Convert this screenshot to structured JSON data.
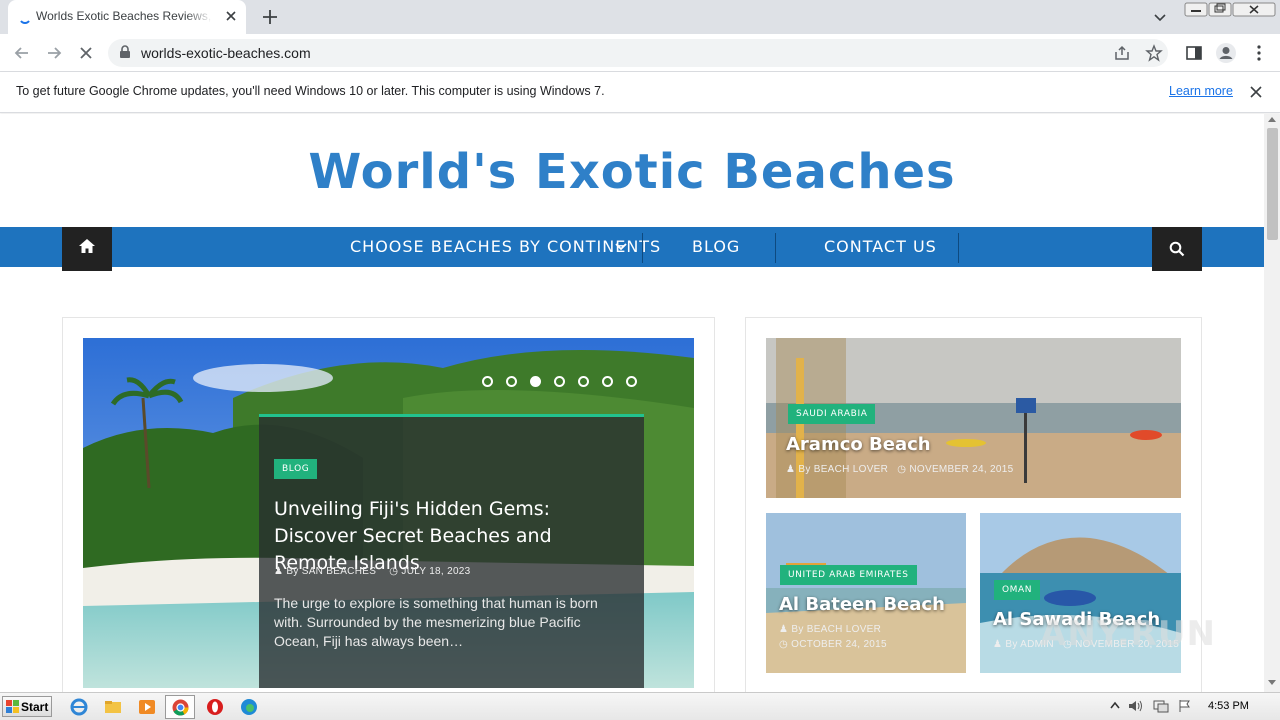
{
  "browser": {
    "tab_title": "Worlds Exotic Beaches Reviews, Travel",
    "url": "worlds-exotic-beaches.com",
    "infobar_message": "To get future Google Chrome updates, you'll need Windows 10 or later. This computer is using Windows 7.",
    "infobar_link": "Learn more"
  },
  "site": {
    "logo": "World's Exotic Beaches",
    "nav": {
      "items": [
        "CHOOSE BEACHES BY CONTINENTS",
        "BLOG",
        "CONTACT US"
      ]
    }
  },
  "slider": {
    "active_index": 2,
    "dot_count": 7,
    "category": "BLOG",
    "title": "Unveiling Fiji's Hidden Gems: Discover Secret Beaches and Remote Islands",
    "author_prefix": "By",
    "author": "SAN BEACHES",
    "date": "JULY 18, 2023",
    "excerpt": "The urge to explore is something that human is born with. Surrounded by the mesmerizing blue Pacific Ocean, Fiji has always been…"
  },
  "cards": [
    {
      "category": "SAUDI ARABIA",
      "title": "Aramco Beach",
      "author_prefix": "By",
      "author": "BEACH LOVER",
      "date": "NOVEMBER 24, 2015"
    },
    {
      "category": "UNITED ARAB EMIRATES",
      "title": "Al Bateen Beach",
      "author_prefix": "By",
      "author": "BEACH LOVER",
      "date": "OCTOBER 24, 2015"
    },
    {
      "category": "OMAN",
      "title": "Al Sawadi Beach",
      "author_prefix": "By",
      "author": "ADMIN",
      "date": "NOVEMBER 20, 2015"
    }
  ],
  "watermark": "ANY.RUN",
  "taskbar": {
    "start_label": "Start",
    "clock": "4:53 PM"
  },
  "colors": {
    "nav_blue": "#1e73be",
    "logo_blue": "#2f80c8",
    "badge_green": "#21b27d"
  }
}
